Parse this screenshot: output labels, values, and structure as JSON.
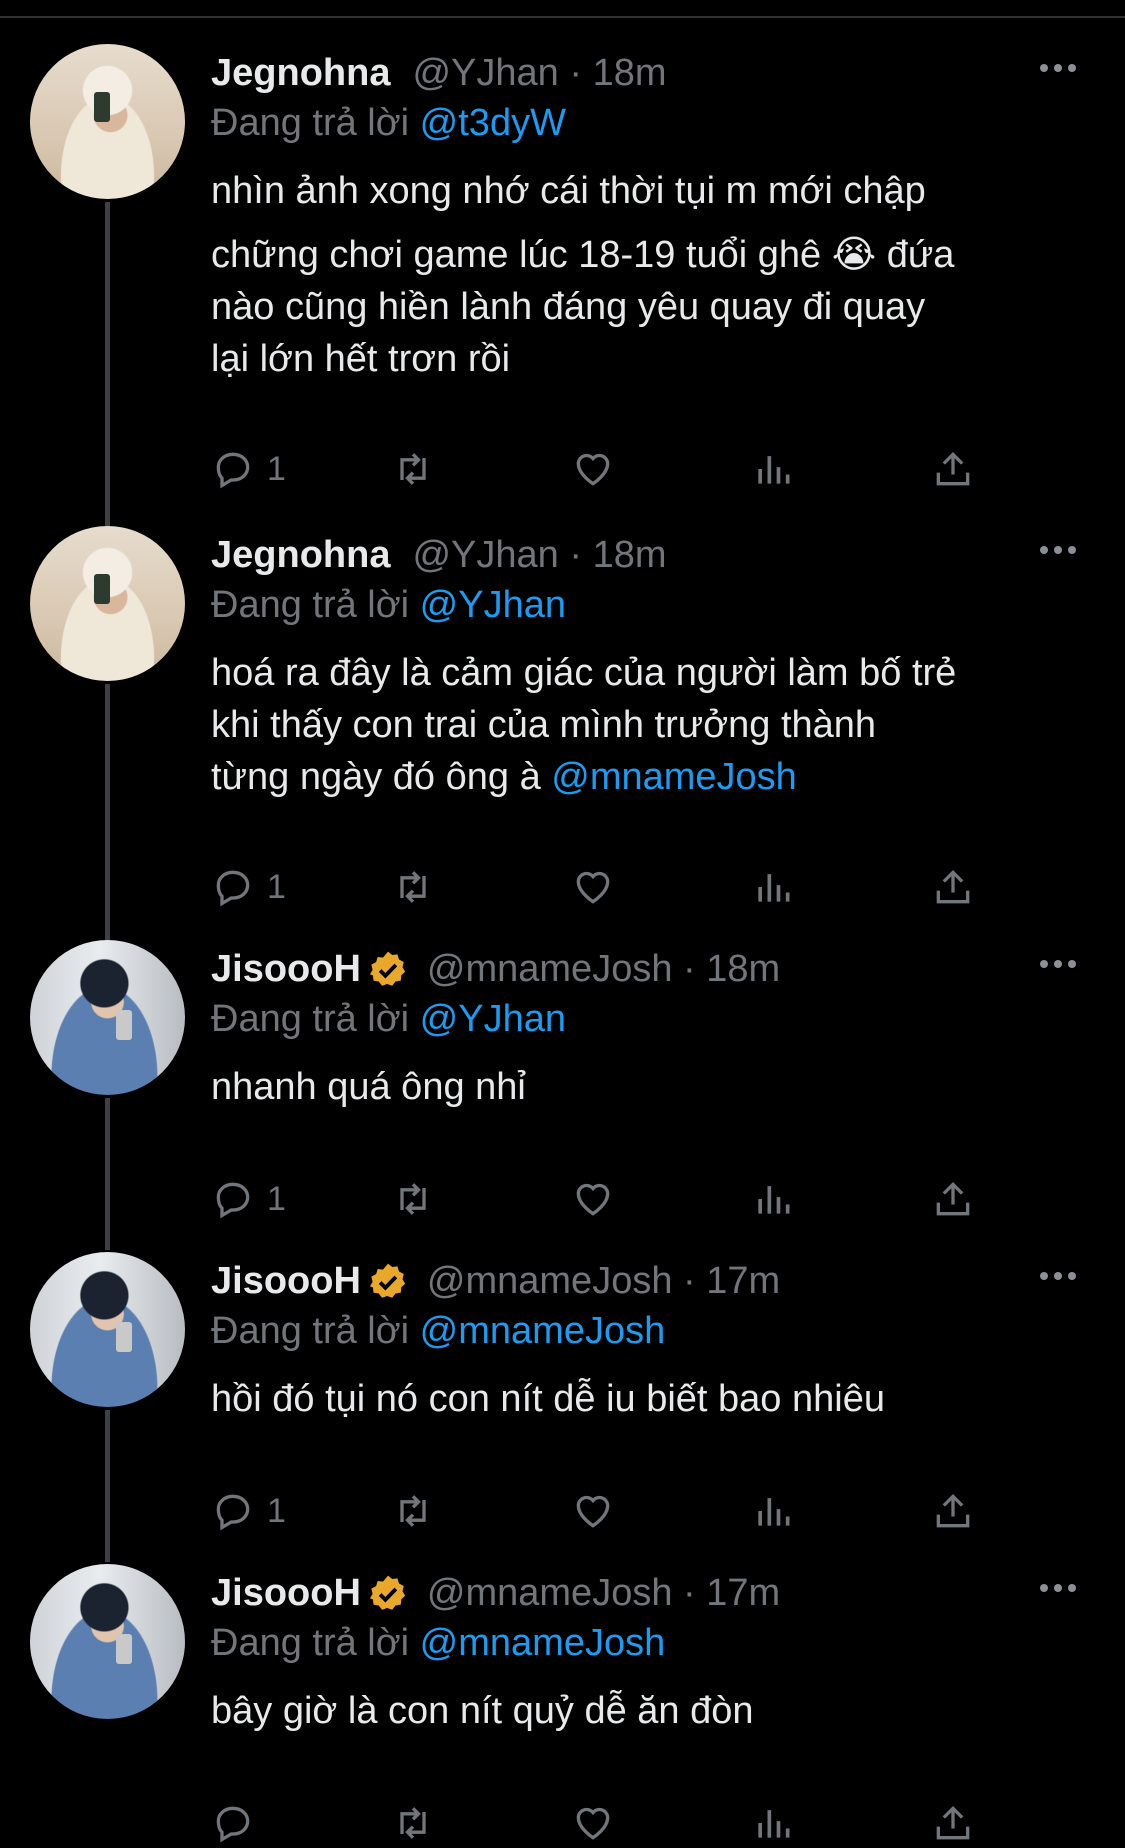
{
  "tweets": [
    {
      "name": "Jegnohna",
      "verified": false,
      "handle": "@YJhan",
      "time": "· 18m",
      "reply_prefix": "Đang trả lời ",
      "reply_to": "@t3dyW",
      "lines": [
        "nhìn ảnh xong nhớ cái thời tụi m mới chập",
        "chững chơi game lúc 18-19 tuổi ghê 😭  đứa",
        "nào cũng hiền lành đáng yêu quay đi quay",
        "lại lớn hết trơn rồi"
      ],
      "reply_count": "1"
    },
    {
      "name": "Jegnohna",
      "verified": false,
      "handle": "@YJhan",
      "time": "· 18m",
      "reply_prefix": "Đang trả lời ",
      "reply_to": "@YJhan",
      "lines": [
        "hoá ra đây là cảm giác của người làm bố trẻ",
        "khi thấy con trai của mình trưởng thành",
        "từng ngày đó ông à "
      ],
      "inline_mention": "@mnameJosh",
      "reply_count": "1"
    },
    {
      "name": "JisoooH",
      "verified": true,
      "handle": "@mnameJosh",
      "time": "· 18m",
      "reply_prefix": "Đang trả lời ",
      "reply_to": "@YJhan",
      "lines": [
        "nhanh quá ông nhỉ"
      ],
      "reply_count": "1"
    },
    {
      "name": "JisoooH",
      "verified": true,
      "handle": "@mnameJosh",
      "time": "· 17m",
      "reply_prefix": "Đang trả lời ",
      "reply_to": "@mnameJosh",
      "lines": [
        "hồi đó tụi nó con nít dễ iu biết bao nhiêu"
      ],
      "reply_count": "1"
    },
    {
      "name": "JisoooH",
      "verified": true,
      "handle": "@mnameJosh",
      "time": "· 17m",
      "reply_prefix": "Đang trả lời ",
      "reply_to": "@mnameJosh",
      "lines": [
        "bây giờ là con nít quỷ dễ ăn đòn"
      ],
      "reply_count": ""
    }
  ],
  "icons": {
    "reply": "reply-icon",
    "retweet": "retweet-icon",
    "like": "heart-icon",
    "views": "views-icon",
    "share": "share-icon",
    "more": "more-icon",
    "verified": "verified-badge-icon"
  },
  "colors": {
    "background": "#000000",
    "text": "#e7e9ea",
    "muted": "#71767b",
    "link": "#1d9bf0",
    "verified": "#e8a82c"
  }
}
